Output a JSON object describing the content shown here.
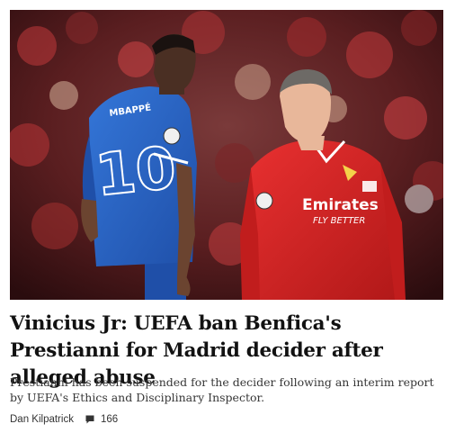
{
  "article": {
    "image": {
      "left_player_shirt_name": "MBAPPÉ",
      "left_player_shirt_number": "10",
      "right_player_sponsor_line1": "Emirates",
      "right_player_sponsor_line2": "FLY BETTER"
    },
    "headline": "Vinicius Jr: UEFA ban Benfica's Prestianni for Madrid decider after alleged abuse",
    "summary": "Prestianni has been suspended for the decider following an interim report by UEFA's Ethics and Disciplinary Inspector.",
    "author": "Dan Kilpatrick",
    "comment_count": "166"
  },
  "colors": {
    "madrid_blue": "#2a64c4",
    "benfica_red": "#d42020",
    "background": "#ffffff",
    "headline": "#121212"
  },
  "icons": [
    "comment-icon"
  ]
}
